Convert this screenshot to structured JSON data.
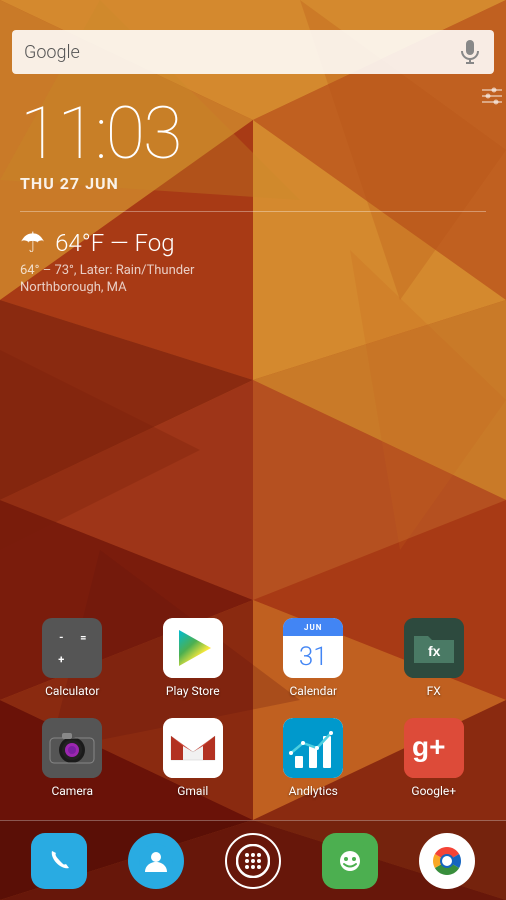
{
  "searchbar": {
    "text": "Google",
    "mic_icon": "🎤"
  },
  "clock": {
    "time": "11:03",
    "day": "THU",
    "date": "27",
    "month": "JUN"
  },
  "weather": {
    "icon": "☂",
    "temp": "64°F — Fog",
    "range": "64° – 73°, Later: Rain/Thunder",
    "location": "Northborough, MA"
  },
  "apps": [
    {
      "id": "calculator",
      "label": "Calculator",
      "color": "#555555"
    },
    {
      "id": "play-store",
      "label": "Play Store",
      "color": "#ffffff"
    },
    {
      "id": "calendar",
      "label": "Calendar",
      "color": "#ffffff"
    },
    {
      "id": "fx",
      "label": "FX",
      "color": "#2d4a3e"
    },
    {
      "id": "camera",
      "label": "Camera",
      "color": "#555555"
    },
    {
      "id": "gmail",
      "label": "Gmail",
      "color": "#ffffff"
    },
    {
      "id": "analytics",
      "label": "Andlytics",
      "color": "#0099cc"
    },
    {
      "id": "google-plus",
      "label": "Google+",
      "color": "#dd4b39"
    }
  ],
  "dock": [
    {
      "id": "phone",
      "label": "Phone"
    },
    {
      "id": "contacts",
      "label": "Contacts"
    },
    {
      "id": "apps",
      "label": "Apps"
    },
    {
      "id": "facesmile",
      "label": "Facesmile"
    },
    {
      "id": "chrome",
      "label": "Chrome"
    }
  ]
}
